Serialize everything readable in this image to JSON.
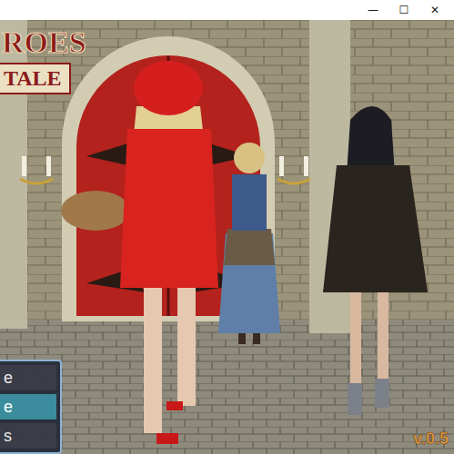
{
  "window": {
    "controls": [
      "—",
      "☐",
      "✕"
    ]
  },
  "title": {
    "line1": "ROES",
    "line2": "TALE"
  },
  "menu": [
    {
      "label": "e",
      "selected": false
    },
    {
      "label": "e",
      "selected": true
    },
    {
      "label": "s",
      "selected": false
    }
  ],
  "version": "v.0.5"
}
